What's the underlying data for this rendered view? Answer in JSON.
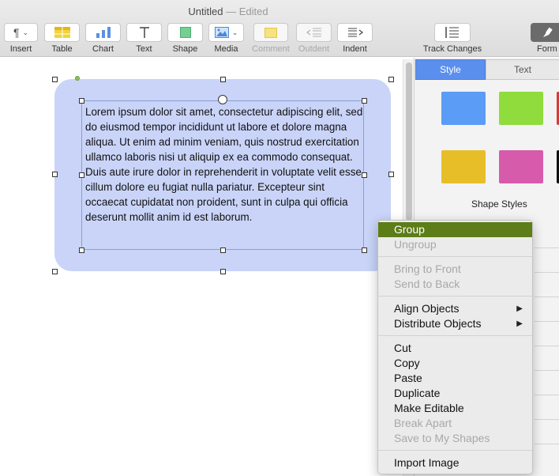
{
  "window": {
    "title": "Untitled",
    "status": "— Edited"
  },
  "toolbar": {
    "insert": "Insert",
    "table": "Table",
    "chart": "Chart",
    "text": "Text",
    "shape": "Shape",
    "media": "Media",
    "comment": "Comment",
    "outdent": "Outdent",
    "indent": "Indent",
    "track_changes": "Track Changes",
    "format": "Form"
  },
  "document": {
    "body_text": "Lorem ipsum dolor sit amet, consectetur adipiscing elit, sed do eiusmod tempor incididunt ut labore et dolore magna aliqua. Ut enim ad minim veniam, quis nostrud exercitation ullamco laboris nisi ut aliquip ex ea commodo consequat. Duis aute irure dolor in reprehenderit in voluptate velit esse cillum dolore eu fugiat nulla pariatur. Excepteur sint occaecat cupidatat non proident, sunt in culpa qui officia deserunt mollit anim id est laborum.",
    "shape_fill": "#c9d4f8"
  },
  "inspector": {
    "tabs": [
      {
        "label": "Style"
      },
      {
        "label": "Text"
      }
    ],
    "styles_label": "Shape Styles",
    "swatches": [
      "#5b9cf6",
      "#8fdc3c",
      "#d63a3a",
      "#e8be28",
      "#d65bab",
      "#111111"
    ]
  },
  "context_menu": {
    "highlight_color": "#5c7d17",
    "items": [
      {
        "label": "Group"
      },
      {
        "label": "Ungroup"
      },
      {
        "label": "Bring to Front"
      },
      {
        "label": "Send to Back"
      },
      {
        "label": "Align Objects"
      },
      {
        "label": "Distribute Objects"
      },
      {
        "label": "Cut"
      },
      {
        "label": "Copy"
      },
      {
        "label": "Paste"
      },
      {
        "label": "Duplicate"
      },
      {
        "label": "Make Editable"
      },
      {
        "label": "Break Apart"
      },
      {
        "label": "Save to My Shapes"
      },
      {
        "label": "Import Image"
      }
    ]
  }
}
